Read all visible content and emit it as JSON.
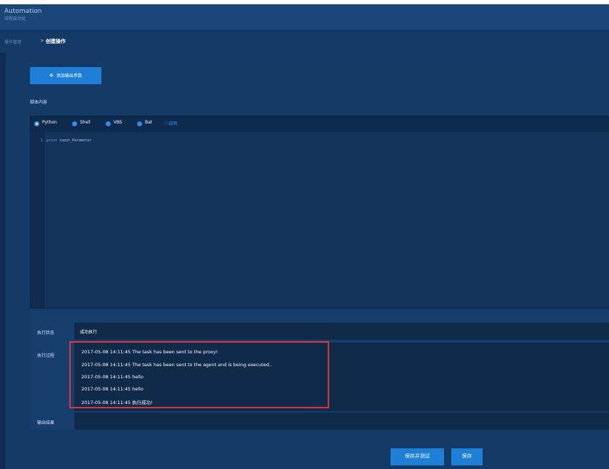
{
  "header": {
    "app_title": "Automation",
    "app_subtitle": "流程自动化"
  },
  "breadcrumb": {
    "parent": "操作管理",
    "separator": ">",
    "current": "创建操作"
  },
  "toolbar": {
    "add_param_label": "添加输出参数"
  },
  "script_section": {
    "label": "脚本内容"
  },
  "languages": [
    {
      "label": "Python",
      "selected": true
    },
    {
      "label": "Shell",
      "selected": false
    },
    {
      "label": "VBS",
      "selected": false
    },
    {
      "label": "Bat",
      "selected": false
    }
  ],
  "help_link": "ⓘ说明",
  "editor": {
    "line_number": "1",
    "keyword": "print",
    "code_rest": " input_Parameter"
  },
  "execution": {
    "status_label": "执行状态",
    "status_value": "成功执行",
    "log_label": "执行过程",
    "log_lines": [
      "2017-05-08 14:11:45 The task has been sent to the proxy!",
      "2017-05-08 14:11:45 The task has been sent to the agent and is being executed..",
      "2017-05-08 14:11:45 hello",
      "2017-05-08 14:11:45 hello",
      "2017-05-08 14:11:45 执行成功!"
    ],
    "output_label": "输出结果"
  },
  "footer": {
    "save_test_label": "保存并测试",
    "save_label": "保存"
  },
  "colors": {
    "accent": "#1d7fd6",
    "highlight": "#e0363b"
  }
}
